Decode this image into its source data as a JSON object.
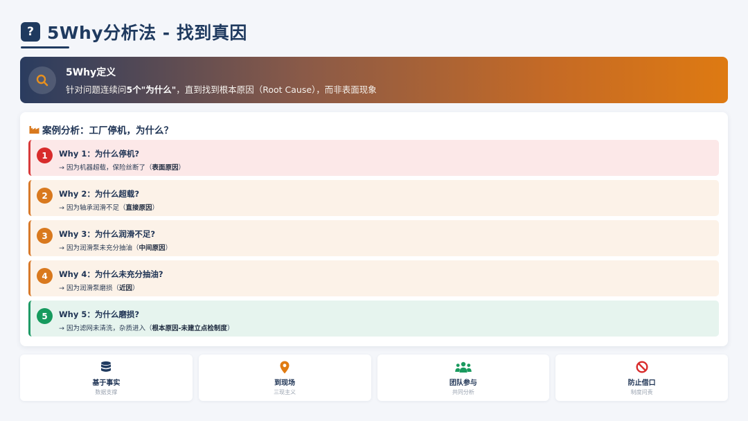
{
  "header": {
    "icon": "question-icon",
    "icon_glyph": "?",
    "title": "5Why分析法 - 找到真因"
  },
  "definition": {
    "icon": "search-icon",
    "title": "5Why定义",
    "desc_before": "针对问题连续问",
    "desc_bold": "5个\"为什么\"",
    "desc_after": "，直到找到根本原因（Root Cause），而非表面现象"
  },
  "case": {
    "icon": "factory-icon",
    "title": "案例分析：工厂停机，为什么？",
    "whys": [
      {
        "num": "1",
        "question": "Why 1：为什么停机?",
        "answer": "→ 因为机器超载，保险丝断了（",
        "tag": "表面原因",
        "close": "）",
        "level": "red"
      },
      {
        "num": "2",
        "question": "Why 2：为什么超载?",
        "answer": "→ 因为轴承润滑不足（",
        "tag": "直接原因",
        "close": "）",
        "level": "orange"
      },
      {
        "num": "3",
        "question": "Why 3：为什么润滑不足?",
        "answer": "→ 因为润滑泵未充分抽油（",
        "tag": "中间原因",
        "close": "）",
        "level": "orange"
      },
      {
        "num": "4",
        "question": "Why 4：为什么未充分抽油?",
        "answer": "→ 因为润滑泵磨损（",
        "tag": "近因",
        "close": "）",
        "level": "orange"
      },
      {
        "num": "5",
        "question": "Why 5：为什么磨损?",
        "answer": "→ 因为滤网未清洗，杂质进入（",
        "tag": "根本原因-未建立点检制度",
        "close": "）",
        "level": "green"
      }
    ]
  },
  "principles": [
    {
      "icon": "database-icon",
      "color": "#1f3a5f",
      "title": "基于事实",
      "subtitle": "数据支撑"
    },
    {
      "icon": "location-pin-icon",
      "color": "#e07b12",
      "title": "到现场",
      "subtitle": "三现主义"
    },
    {
      "icon": "team-icon",
      "color": "#1a9a5e",
      "title": "团队参与",
      "subtitle": "共同分析"
    },
    {
      "icon": "ban-icon",
      "color": "#d82c2c",
      "title": "防止借口",
      "subtitle": "制度问责"
    }
  ]
}
